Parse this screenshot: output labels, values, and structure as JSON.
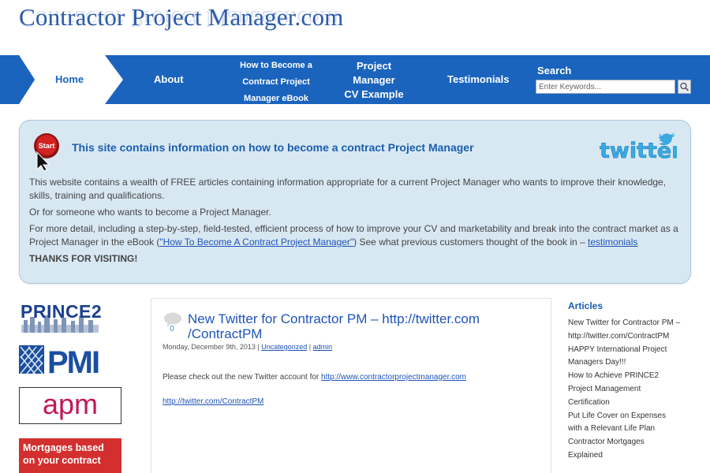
{
  "header": {
    "site_title": "Contractor Project Manager.com"
  },
  "nav": {
    "home": "Home",
    "about": "About",
    "ebook": [
      "How to Become a",
      "Contract Project",
      "Manager eBook"
    ],
    "cv": [
      "Project",
      "Manager",
      "CV Example"
    ],
    "testimonials": "Testimonials",
    "search_label": "Search",
    "search_placeholder": "Enter Keywords...",
    "search_icon": "magnifier-icon"
  },
  "info": {
    "heading": "This site contains information on how to become a contract Project Manager",
    "start_icon_text": "Start",
    "twitter_logo": "twitter",
    "para1": "This website contains a wealth of FREE articles containing information appropriate for a current Project Manager who wants to improve their knowledge, skills, training and qualifications.",
    "para2": "Or for someone who wants to become a Project Manager.",
    "para3_before": "For more detail, including a step-by-step, field-tested, efficient process of how to improve your CV and marketability and break into the contract market as a Project Manager in the eBook (",
    "para3_link": "\"How To Become A Contract Project Manager\"",
    "para3_after": ") See what previous customers thought of the book in – ",
    "para3_link2": "testimonials",
    "thanks": "THANKS FOR VISITING!"
  },
  "left_logos": {
    "prince2": "PRINCE2",
    "pmi": "PMI",
    "apm": "apm",
    "mortgage": [
      "Mortgages based",
      "on your contract"
    ]
  },
  "post": {
    "comment_count": "0",
    "title": "New Twitter for Contractor PM – http://twitter.com /ContractPM",
    "date": "Monday, December 9th, 2013",
    "category": "Uncategorized",
    "author": "admin",
    "text_before": "Please check out the new Twitter account for ",
    "text_link": "http://www.contractorprojectmanager.com",
    "twitter_link": "http://twitter.com/ContractPM"
  },
  "sidebar": {
    "heading": "Articles",
    "lines": [
      "New Twitter for Contractor PM –",
      "http://twitter.com/ContractPM",
      "HAPPY International Project",
      "Managers Day!!!",
      "How to Achieve PRINCE2",
      "Project Management",
      "Certification",
      "Put Life Cover on Expenses",
      "with a Relevant Life Plan",
      "Contractor Mortgages",
      "Explained"
    ]
  },
  "colors": {
    "nav_blue": "#1a64be",
    "link_blue": "#1f54b8",
    "info_bg": "#d8e8f3"
  }
}
